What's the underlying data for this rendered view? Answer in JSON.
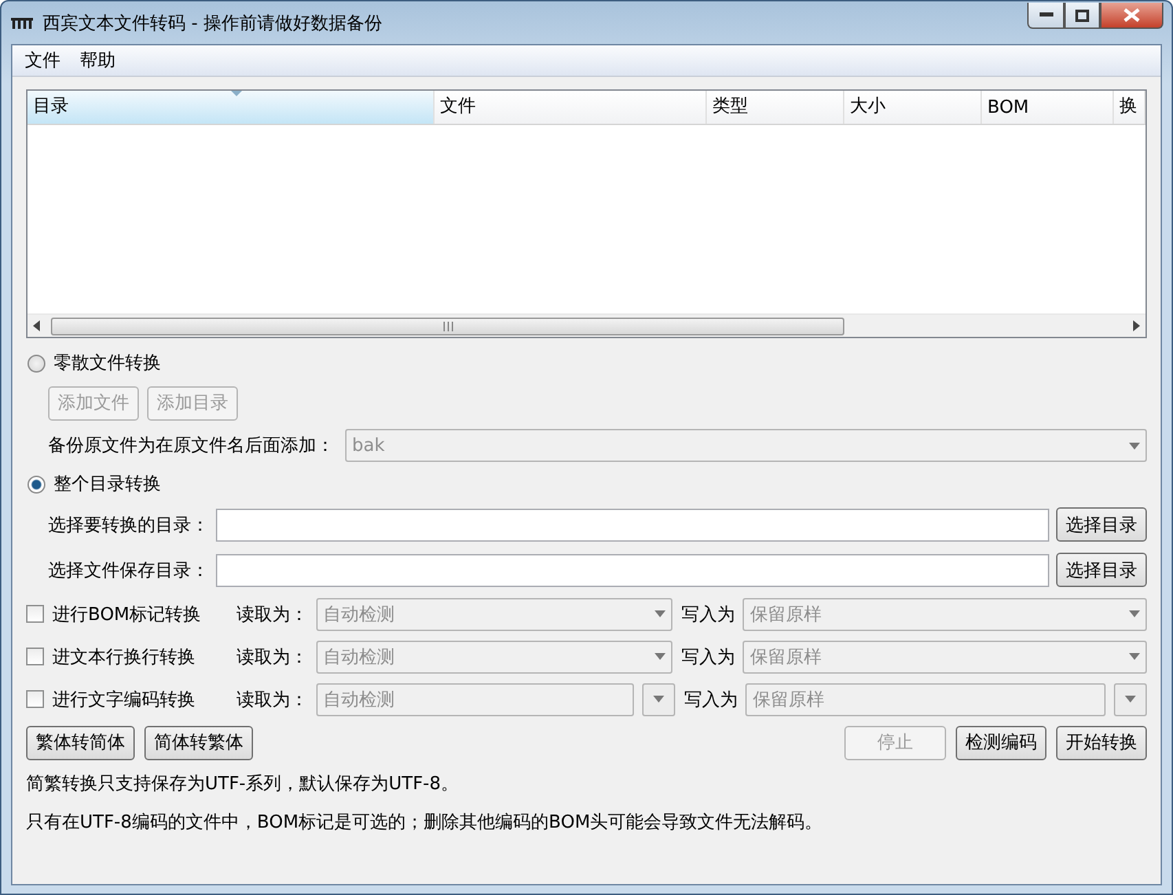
{
  "window": {
    "title": "西宾文本文件转码 - 操作前请做好数据备份"
  },
  "menu": [
    "文件",
    "帮助"
  ],
  "table": {
    "columns": [
      {
        "label": "目录",
        "sorted": true
      },
      {
        "label": "文件",
        "sorted": false
      },
      {
        "label": "类型",
        "sorted": false
      },
      {
        "label": "大小",
        "sorted": false
      },
      {
        "label": "BOM",
        "sorted": false
      },
      {
        "label": "换",
        "sorted": false
      }
    ]
  },
  "modes": [
    {
      "label": "零散文件转换",
      "selected": false,
      "buttons": [
        {
          "label": "添加文件",
          "disabled": true
        },
        {
          "label": "添加目录",
          "disabled": true
        }
      ],
      "backup": {
        "label": "备份原文件为在原文件名后面添加：",
        "value": "bak",
        "disabled": true
      }
    },
    {
      "label": "整个目录转换",
      "selected": true,
      "fields": [
        {
          "label": "选择要转换的目录：",
          "button": "选择目录"
        },
        {
          "label": "选择文件保存目录：",
          "button": "选择目录"
        }
      ]
    }
  ],
  "conversions": [
    {
      "kind": "dropdown",
      "label": "进行BOM标记转换",
      "checked": false,
      "read_label": "读取为：",
      "read_value": "自动检测",
      "write_label": "写入为",
      "write_value": "保留原样"
    },
    {
      "kind": "dropdown",
      "label": "进文本行换行转换",
      "checked": false,
      "read_label": "读取为：",
      "read_value": "自动检测",
      "write_label": "写入为",
      "write_value": "保留原样"
    },
    {
      "kind": "editable",
      "label": "进行文字编码转换",
      "checked": false,
      "read_label": "读取为：",
      "read_value": "自动检测",
      "write_label": "写入为",
      "write_value": "保留原样"
    }
  ],
  "left_buttons": [
    {
      "label": "繁体转简体",
      "disabled": false
    },
    {
      "label": "简体转繁体",
      "disabled": false
    }
  ],
  "right_buttons": [
    {
      "label": "停止",
      "disabled": true
    },
    {
      "label": "检测编码",
      "disabled": false
    },
    {
      "label": "开始转换",
      "disabled": false
    }
  ],
  "notes": [
    "简繁转换只支持保存为UTF-系列，默认保存为UTF-8。",
    "只有在UTF-8编码的文件中，BOM标记是可选的；删除其他编码的BOM头可能会导致文件无法解码。"
  ]
}
